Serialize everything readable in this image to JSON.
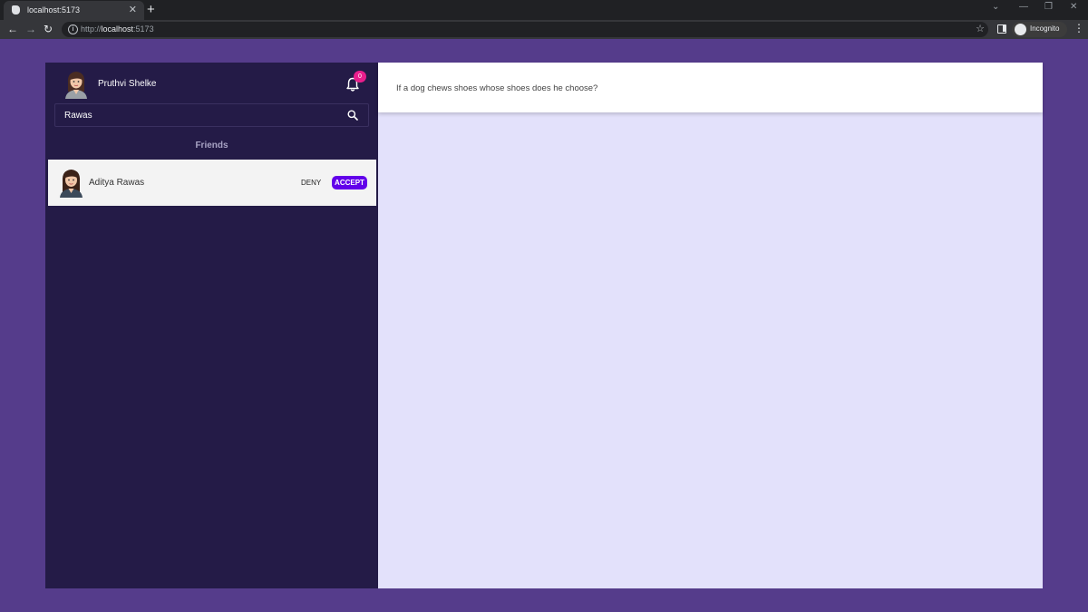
{
  "browser": {
    "tab_title": "localhost:5173",
    "url_prefix": "http://",
    "url_host": "localhost",
    "url_port": ":5173",
    "profile_label": "Incognito"
  },
  "user": {
    "name": "Pruthvi Shelke"
  },
  "notifications": {
    "count": "0"
  },
  "search": {
    "value": "Rawas"
  },
  "friends": {
    "title": "Friends",
    "requests": [
      {
        "name": "Aditya Rawas",
        "deny_label": "DENY",
        "accept_label": "ACCEPT"
      }
    ]
  },
  "main": {
    "quote": "If a dog chews shoes whose shoes does he choose?"
  },
  "colors": {
    "page_bg": "#553c8b",
    "sidebar_bg": "#241b47",
    "main_bg": "#e3e1fb",
    "accent": "#6200ea",
    "badge": "#e91e8c"
  }
}
